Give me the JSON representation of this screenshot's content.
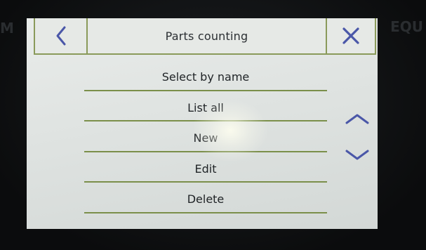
{
  "header": {
    "title": "Parts counting",
    "back_icon": "chevron-left-icon",
    "close_icon": "close-icon"
  },
  "bezel": {
    "left_text": "M",
    "right_text": "EQU"
  },
  "menu": {
    "items": [
      {
        "label": "Select by name"
      },
      {
        "label": "List all"
      },
      {
        "label": "New"
      },
      {
        "label": "Edit"
      },
      {
        "label": "Delete"
      }
    ]
  },
  "scroll": {
    "up_icon": "chevron-up-icon",
    "down_icon": "chevron-down-icon"
  },
  "colors": {
    "accent_line": "#7b8f4a",
    "icon_blue": "#4a57a8",
    "screen_bg": "#e2e6e4"
  }
}
